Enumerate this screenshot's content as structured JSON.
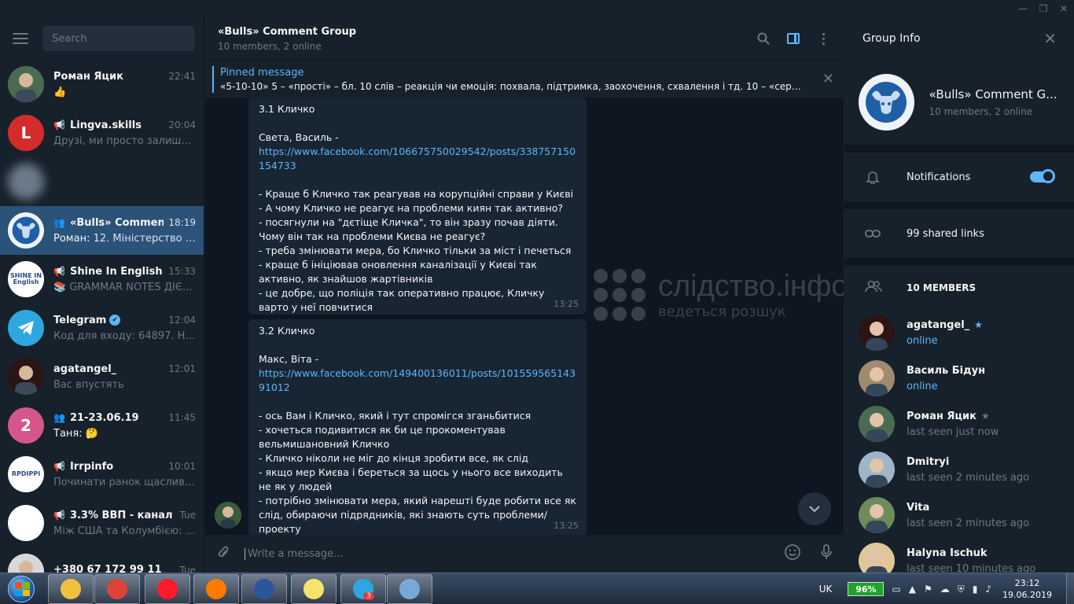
{
  "window": {
    "controls": [
      "—",
      "❐",
      "✕"
    ]
  },
  "sidebar": {
    "search_placeholder": "Search",
    "chats": [
      {
        "name": "Роман Яцик",
        "time": "22:41",
        "preview": "👍",
        "avatar_color": "#4a6b52",
        "type": "user"
      },
      {
        "name": "Lingva.skills",
        "time": "20:04",
        "preview": "Друзі, ми просто залишимо...",
        "avatar_color": "#d42b2b",
        "type": "channel",
        "avatar_text": "L"
      },
      {
        "name": "",
        "time": "",
        "preview": "",
        "avatar_color": "#6b7a88",
        "type": "blurred"
      },
      {
        "name": "«Bulls» Comment ...",
        "time": "18:19",
        "sender": "Роман:",
        "preview": " 12. Міністерство Лю...",
        "avatar_color": "#eef3f8",
        "type": "group",
        "active": true
      },
      {
        "name": "Shine In English",
        "time": "15:33",
        "preview": "📚 GRAMMAR NOTES ДІЄСЛ...",
        "avatar_color": "#ffffff",
        "type": "channel",
        "avatar_text": "SHINE IN English"
      },
      {
        "name": "Telegram",
        "time": "12:04",
        "preview": "Код для входу: 64897. Не по...",
        "avatar_color": "#2ea6df",
        "type": "verified"
      },
      {
        "name": "agatangel_",
        "time": "12:01",
        "preview": "Вас впустять",
        "avatar_color": "#2a1414",
        "type": "user"
      },
      {
        "name": "21-23.06.19",
        "time": "11:45",
        "sender": "Таня:",
        "preview": " 🤔",
        "avatar_color": "#d4568a",
        "type": "group",
        "avatar_text": "2"
      },
      {
        "name": "Irrpinfo",
        "time": "10:01",
        "preview": "Починати ранок щасливим...",
        "avatar_color": "#ffffff",
        "type": "channel",
        "avatar_text": "RPDIPPI"
      },
      {
        "name": "3.3% ВВП - канал V...",
        "time": "Tue",
        "preview": "Між США та Колумбією: чи...",
        "avatar_color": "#ffffff",
        "type": "channel"
      },
      {
        "name": "+380 67 172 99 11",
        "time": "Tue",
        "preview": "",
        "avatar_color": "#d8d8d8",
        "type": "user"
      }
    ]
  },
  "chat": {
    "title": "«Bulls» Comment Group",
    "subtitle": "10 members, 2 online",
    "pinned_label": "Pinned message",
    "pinned_text": "«5-10-10»  5 – «прості» – бл. 10 слів – реакція чи емоція: похвала, підтримка, заохочення, схвалення і тд. 10 – «середні» ...",
    "messages": [
      {
        "head": "3.1 Кличко\n\nСвета, Василь -\n",
        "link": "https://www.facebook.com/106675750029542/posts/338757150154733",
        "tail": "\n\n- Краще б Кличко так реагував на корупційні справи у Києві\n- А чому Кличко не реагує на проблеми киян так активно?\n- посягнули на \"дєтіще Кличка\", то він зразу почав діяти. Чому він так на проблеми Києва не реагує?\n- треба змінювати мера, бо Кличко тільки за міст і печеться\n- краще б ініціював оновлення каналізації у Києві так активно, як знайшов жартівників\n- це добре, що поліція так оперативно працює, Кличку варто у неї повчитися",
        "time": "13:25"
      },
      {
        "head": "3.2 Кличко\n\nМакс, Віта -\n",
        "link": "https://www.facebook.com/149400136011/posts/10155956514391012",
        "tail": "\n\n- ось Вам і Кличко, який і тут спромігся зганьбитися\n- хочеться подивитися як би це прокоментував вельмишановний Кличко\n- Кличко ніколи не міг до кінця зробити все, як слід\n- якщо мер Києва і береться за щось у нього все виходить не як у людей\n- потрібно змінювати мера, який нарешті буде робити все як слід, обираючи підрядників, які знають суть проблеми/проекту",
        "time": "13:25"
      }
    ],
    "watermark_main": "слідство.інфо",
    "watermark_sub": "ведеться розшук",
    "composer_placeholder": "Write a message..."
  },
  "info": {
    "title": "Group Info",
    "group_name": "«Bulls» Comment G...",
    "group_sub": "10 members, 2 online",
    "notifications_label": "Notifications",
    "notifications_on": true,
    "shared_links": "99 shared links",
    "members_header": "10 MEMBERS",
    "members": [
      {
        "name": "agatangel_",
        "status": "online",
        "online": true,
        "admin": true,
        "avatar_color": "#2a1414"
      },
      {
        "name": "Василь Бідун",
        "status": "online",
        "online": true,
        "admin": false,
        "avatar_color": "#a08a70"
      },
      {
        "name": "Роман Яцик",
        "status": "last seen just now",
        "online": false,
        "admin": true,
        "avatar_color": "#4a6b52"
      },
      {
        "name": "Dmitryi",
        "status": "last seen 2 minutes ago",
        "online": false,
        "admin": false,
        "avatar_color": "#9fb5c8"
      },
      {
        "name": "Vita",
        "status": "last seen 2 minutes ago",
        "online": false,
        "admin": false,
        "avatar_color": "#6e8b5a"
      },
      {
        "name": "Halyna Ischuk",
        "status": "last seen 10 minutes ago",
        "online": false,
        "admin": false,
        "avatar_color": "#e0c79a"
      }
    ]
  },
  "taskbar": {
    "apps": [
      {
        "name": "explorer",
        "color": "#f0c040"
      },
      {
        "name": "chrome",
        "color": "#db4437"
      },
      {
        "name": "opera",
        "color": "#ff1b2d"
      },
      {
        "name": "firefox",
        "color": "#ff7a00"
      },
      {
        "name": "word",
        "color": "#2b579a"
      },
      {
        "name": "sticky-notes",
        "color": "#f7e26b"
      },
      {
        "name": "telegram",
        "color": "#2ea6df",
        "badge": "3"
      },
      {
        "name": "paint",
        "color": "#7aa8d6"
      }
    ],
    "language": "UK",
    "battery": "96%",
    "time": "23:12",
    "date": "19.06.2019"
  }
}
